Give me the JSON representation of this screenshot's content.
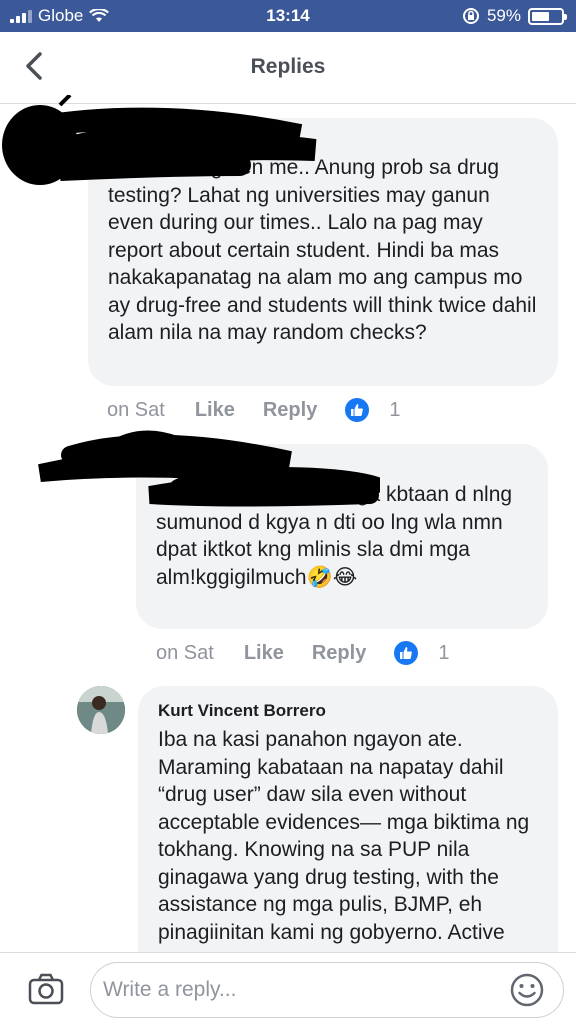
{
  "status_bar": {
    "carrier": "Globe",
    "time": "13:14",
    "battery_percent": "59%",
    "battery_level": 0.59,
    "signal_bars": 3,
    "icons": [
      "signal-icon",
      "wifi-icon",
      "rotation-lock-icon",
      "battery-icon"
    ]
  },
  "header": {
    "title": "Replies",
    "back_icon": "chevron-left-icon"
  },
  "comments": [
    {
      "author": "",
      "text": "Please enlighten me.. Anung prob sa drug testing? Lahat ng universities may ganun even during our times.. Lalo na pag may report about certain student. Hindi ba mas nakakapanatag na alam mo ang campus mo ay drug-free and students will think twice dahil alam nila na may random checks?",
      "time": "on Sat",
      "like_label": "Like",
      "reply_label": "Reply",
      "reaction_count": "1"
    },
    {
      "author": "",
      "text": "korek dami hanash mga kbtaan d nlng sumunod d kgya n dti oo lng wla nmn dpat iktkot kng mlinis sla dmi mga alm!kggigilmuch🤣😂",
      "time": "on Sat",
      "like_label": "Like",
      "reply_label": "Reply",
      "reaction_count": "1"
    },
    {
      "author": "Kurt Vincent Borrero",
      "text": "Iba na kasi panahon ngayon ate. Maraming kabataan na napatay dahil “drug user” daw sila even without acceptable evidences— mga biktima ng tokhang. Knowing na sa PUP nila ginagawa yang drug testing, with the assistance ng mga pulis, BJMP, eh pinagiinitan kami ng gobyerno. Active"
    }
  ],
  "composer": {
    "placeholder": "Write a reply...",
    "value": "",
    "icons": [
      "camera-icon",
      "smiley-icon"
    ]
  },
  "colors": {
    "status_bar_bg": "#3b5998",
    "like_blue": "#1877f2",
    "bubble_bg": "#f2f3f5",
    "meta_gray": "#90949c"
  }
}
